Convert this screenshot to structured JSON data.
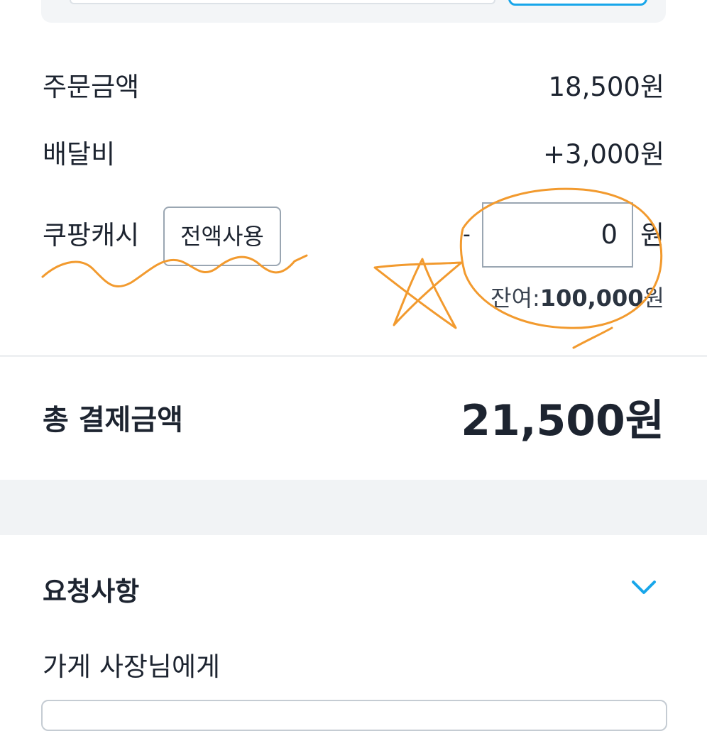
{
  "summary": {
    "order_amount_label": "주문금액",
    "order_amount_value": "18,500원",
    "delivery_fee_label": "배달비",
    "delivery_fee_value": "+3,000원",
    "cash_label": "쿠팡캐시",
    "use_all_button": "전액사용",
    "cash_minus": "-",
    "cash_input_value": "0",
    "cash_unit": "원",
    "balance_prefix": "잔여:",
    "balance_amount": "100,000",
    "balance_suffix": "원"
  },
  "total": {
    "label": "총 결제금액",
    "value": "21,500원"
  },
  "request": {
    "title": "요청사항",
    "expand_icon": "chevron-down-icon",
    "owner_label": "가게 사장님에게"
  },
  "colors": {
    "accent": "#18a6ea",
    "annotation": "#f29a2e",
    "text": "#1d2430",
    "border": "#9aa6b2"
  }
}
